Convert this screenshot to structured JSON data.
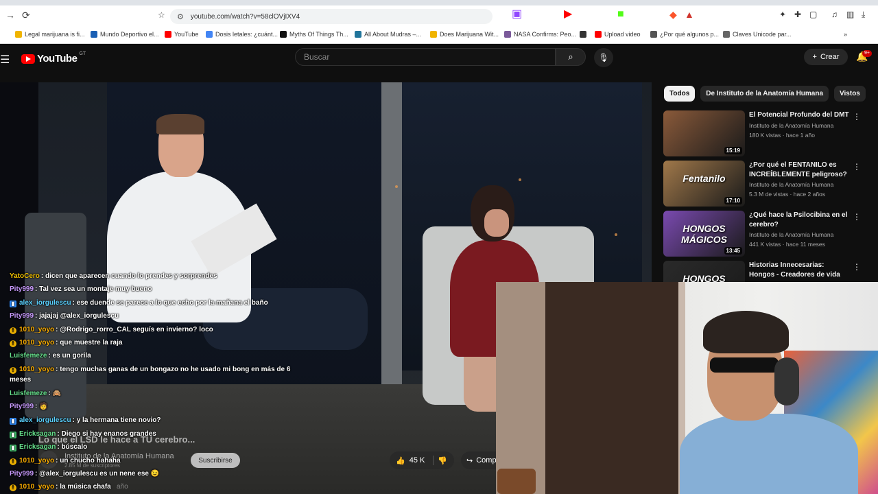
{
  "browser": {
    "url": "youtube.com/watch?v=58clOVjIXV4",
    "bookmarks": [
      {
        "label": "Legal marijuana is fi...",
        "color": "#f0b400"
      },
      {
        "label": "Mundo Deportivo el...",
        "color": "#1a5fb4"
      },
      {
        "label": "YouTube",
        "color": "#ff0000"
      },
      {
        "label": "Dosis letales: ¿cuánt...",
        "color": "#4285f4"
      },
      {
        "label": "Myths Of Things Th...",
        "color": "#111111"
      },
      {
        "label": "All About Mudras –...",
        "color": "#21759b"
      },
      {
        "label": "Does Marijuana Wit...",
        "color": "#f0b400"
      },
      {
        "label": "NASA Confirms: Peo...",
        "color": "#7a5a9a"
      },
      {
        "label": "",
        "color": "#333333"
      },
      {
        "label": "Upload video",
        "color": "#ff0000"
      },
      {
        "label": "¿Por qué algunos p...",
        "color": "#555555"
      },
      {
        "label": "Claves Unicode par...",
        "color": "#666666"
      }
    ]
  },
  "header": {
    "logo": "YouTube",
    "country": "GT",
    "search_placeholder": "Buscar",
    "create": "Crear",
    "notif_badge": "9+"
  },
  "video": {
    "caption": "Lo que el LSD le hace a TU cerebro...",
    "channel": "Instituto de la Anatomía Humana",
    "subscribers": "2.85 M de suscriptores",
    "subscribe": "Suscribirse",
    "likes": "45 K",
    "share": "Compartir",
    "desc_year": "año"
  },
  "chat": [
    {
      "user": "YatoCero",
      "color": "#f0c000",
      "icon": "",
      "text": ": dicen que aparecen cuando lo prendes y sorprendes"
    },
    {
      "user": "Pity999",
      "color": "#c99bff",
      "icon": "",
      "text": ": Tal vez sea un montaje muy bueno"
    },
    {
      "user": "alex_iorgulescu",
      "color": "#5ad1ff",
      "icon": "blue",
      "text": ": ese duende se parece a lo que echo por la mañana el baño"
    },
    {
      "user": "Pity999",
      "color": "#c99bff",
      "icon": "",
      "text": ": jajajaj @alex_iorgulescu"
    },
    {
      "user": "1010_yoyo",
      "color": "#ffb000",
      "icon": "gold",
      "text": ": @Rodrigo_rorro_CAL seguís en invierno? loco"
    },
    {
      "user": "1010_yoyo",
      "color": "#ffb000",
      "icon": "gold",
      "text": ": que muestre la raja"
    },
    {
      "user": "Luisfemeze",
      "color": "#66e08c",
      "icon": "",
      "text": ": es un gorila"
    },
    {
      "user": "1010_yoyo",
      "color": "#ffb000",
      "icon": "gold",
      "text": ": tengo muchas ganas de un bongazo no he usado mi bong en más de 6"
    },
    {
      "user": "",
      "color": "#ffffff",
      "icon": "",
      "text": "meses"
    },
    {
      "user": "Luisfemeze",
      "color": "#66e08c",
      "icon": "",
      "text": ": 🙈"
    },
    {
      "user": "Pity999",
      "color": "#c99bff",
      "icon": "",
      "text": ": 🧑"
    },
    {
      "user": "alex_iorgulescu",
      "color": "#5ad1ff",
      "icon": "blue",
      "text": ": y la hermana tiene novio?"
    },
    {
      "user": "Ericksagan",
      "color": "#66e08c",
      "icon": "green",
      "text": ": Diego si hay enanos grandes"
    },
    {
      "user": "Ericksagan",
      "color": "#66e08c",
      "icon": "green",
      "text": ": búscalo"
    },
    {
      "user": "1010_yoyo",
      "color": "#ffb000",
      "icon": "gold",
      "text": ": un chucho hahaha"
    },
    {
      "user": "Pity999",
      "color": "#c99bff",
      "icon": "",
      "text": ": @alex_iorgulescu es un nene ese 😉"
    },
    {
      "user": "1010_yoyo",
      "color": "#ffb000",
      "icon": "gold",
      "text": ": la música chafa"
    }
  ],
  "sidebar": {
    "chips": [
      "Todos",
      "De Instituto de la Anatomía Humana",
      "Vistos"
    ],
    "recommendations": [
      {
        "title": "El Potencial Profundo del DMT",
        "channel": "Instituto de la Anatomía Humana",
        "meta": "180 K vistas · hace 1 año",
        "duration": "15:19",
        "thumb_color": "#8a5a3a",
        "thumb_text": ""
      },
      {
        "title": "¿Por qué el FENTANILO es INCREÍBLEMENTE peligroso?",
        "channel": "Instituto de la Anatomía Humana",
        "meta": "5.3 M de vistas · hace 2 años",
        "duration": "17:10",
        "thumb_color": "#a0784a",
        "thumb_text": "Fentanilo"
      },
      {
        "title": "¿Qué hace la Psilocibina en el cerebro?",
        "channel": "Instituto de la Anatomía Humana",
        "meta": "441 K vistas · hace 11 meses",
        "duration": "13:45",
        "thumb_color": "#7a4ab0",
        "thumb_text": "HONGOS MÁGICOS"
      },
      {
        "title": "Historias Innecesarias: Hongos - Creadores de vida",
        "channel": "",
        "meta": "",
        "duration": "",
        "thumb_color": "#2a2a2a",
        "thumb_text": "HONGOS"
      }
    ]
  }
}
